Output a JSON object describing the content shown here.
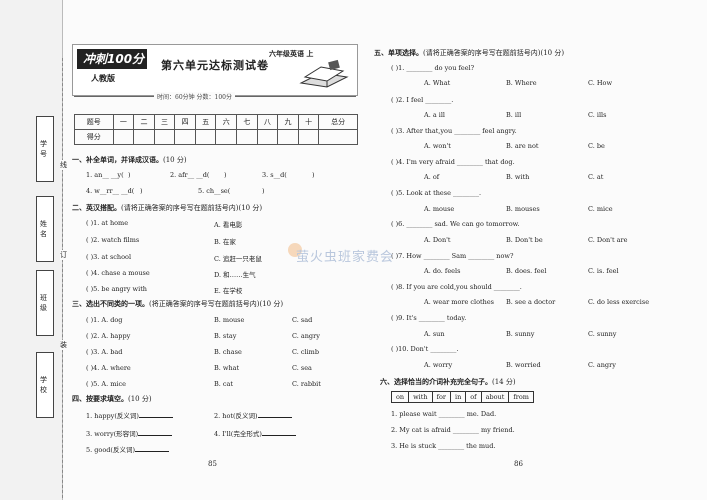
{
  "binding": {
    "labels": [
      "学号",
      "姓名",
      "班级",
      "学校"
    ],
    "cut_marks": [
      "线",
      "订",
      "装"
    ]
  },
  "header": {
    "logo": "冲刺100分",
    "edition": "人教版",
    "title": "第六单元达标测试卷",
    "grade": "六年级英语 上",
    "time_line": "时间：60分钟    分数：100分"
  },
  "score_table": {
    "row1": [
      "题号",
      "一",
      "二",
      "三",
      "四",
      "五",
      "六",
      "七",
      "八",
      "九",
      "十",
      "总分"
    ],
    "row2_label": "得分"
  },
  "left": {
    "s1": {
      "title": "一、补全单词，并译成汉语。",
      "note": "(10 分)",
      "items": [
        "1. an__ __y(",
        "2. afr__ __d(",
        "3. s__d(",
        "4. w__rr__ __d(",
        "5. ch__se(",
        ")"
      ]
    },
    "s2": {
      "title": "二、英汉搭配。",
      "note": "(请将正确答案的序号写在题前括号内)(10 分)",
      "items": [
        {
          "en": "(      )1. at home",
          "zh": "A. 看电影"
        },
        {
          "en": "(      )2. watch films",
          "zh": "B. 在家"
        },
        {
          "en": "(      )3. at school",
          "zh": "C. 追赶一只老鼠"
        },
        {
          "en": "(      )4. chase a mouse",
          "zh": "D. 和……生气"
        },
        {
          "en": "(      )5. be angry with",
          "zh": "E. 在学校"
        }
      ]
    },
    "s3": {
      "title": "三、选出不同类的一项。",
      "note": "(将正确答案的序号写在题前括号内)(10 分)",
      "items": [
        [
          "(      )1. A. dog",
          "B. mouse",
          "C. sad"
        ],
        [
          "(      )2. A. happy",
          "B. stay",
          "C. angry"
        ],
        [
          "(      )3. A. bad",
          "B. chase",
          "C. climb"
        ],
        [
          "(      )4. A. where",
          "B. what",
          "C. sea"
        ],
        [
          "(      )5. A. mice",
          "B. cat",
          "C. rabbit"
        ]
      ]
    },
    "s4": {
      "title": "四、按要求填空。",
      "note": "(10 分)",
      "items": [
        "1. happy(反义词)",
        "2. hot(反义词)",
        "3. worry(形容词)",
        "4. I'll(完全形式)",
        "5. good(反义词)"
      ]
    },
    "page_number": "85"
  },
  "right": {
    "s5": {
      "title": "五、单项选择。",
      "note": "(请将正确答案的序号写在题前括号内)(10 分)",
      "items": [
        {
          "q": "(      )1. ________ do you feel?",
          "opts": [
            "A. What",
            "B. Where",
            "C. How"
          ]
        },
        {
          "q": "(      )2. I feel ________.",
          "opts": [
            "A. a ill",
            "B. ill",
            "C. ills"
          ]
        },
        {
          "q": "(      )3. After that,you ________ feel angry.",
          "opts": [
            "A. won't",
            "B. are not",
            "C. be"
          ]
        },
        {
          "q": "(      )4. I'm very afraid ________ that dog.",
          "opts": [
            "A. of",
            "B. with",
            "C. at"
          ]
        },
        {
          "q": "(      )5. Look at these ________.",
          "opts": [
            "A. mouse",
            "B. mouses",
            "C. mice"
          ]
        },
        {
          "q": "(      )6. ________ sad. We can go tomorrow.",
          "opts": [
            "A. Don't",
            "B. Don't be",
            "C. Don't are"
          ]
        },
        {
          "q": "(      )7. How ________ Sam ________ now?",
          "opts": [
            "A. do. feels",
            "B. does. feel",
            "C. is. feel"
          ]
        },
        {
          "q": "(      )8. If you are cold,you should ________.",
          "opts": [
            "A. wear more clothes",
            "B. see a doctor",
            "C. do less exercise"
          ]
        },
        {
          "q": "(      )9. It's ________ today.",
          "opts": [
            "A. sun",
            "B. sunny",
            "C. sunny"
          ]
        },
        {
          "q": "(      )10. Don't ________.",
          "opts": [
            "A. worry",
            "B. worried",
            "C. angry"
          ]
        }
      ]
    },
    "s6": {
      "title": "六、选择恰当的介词补充完全句子。",
      "note": "(14 分)",
      "words": [
        "on",
        "with",
        "for",
        "in",
        "of",
        "about",
        "from"
      ],
      "items": [
        "1. please wait ________ me. Dad.",
        "2. My cat is afraid ________ my friend.",
        "3. He is stuck ________ the mud."
      ]
    },
    "page_number": "86"
  },
  "watermark": "萤火虫班家费会"
}
